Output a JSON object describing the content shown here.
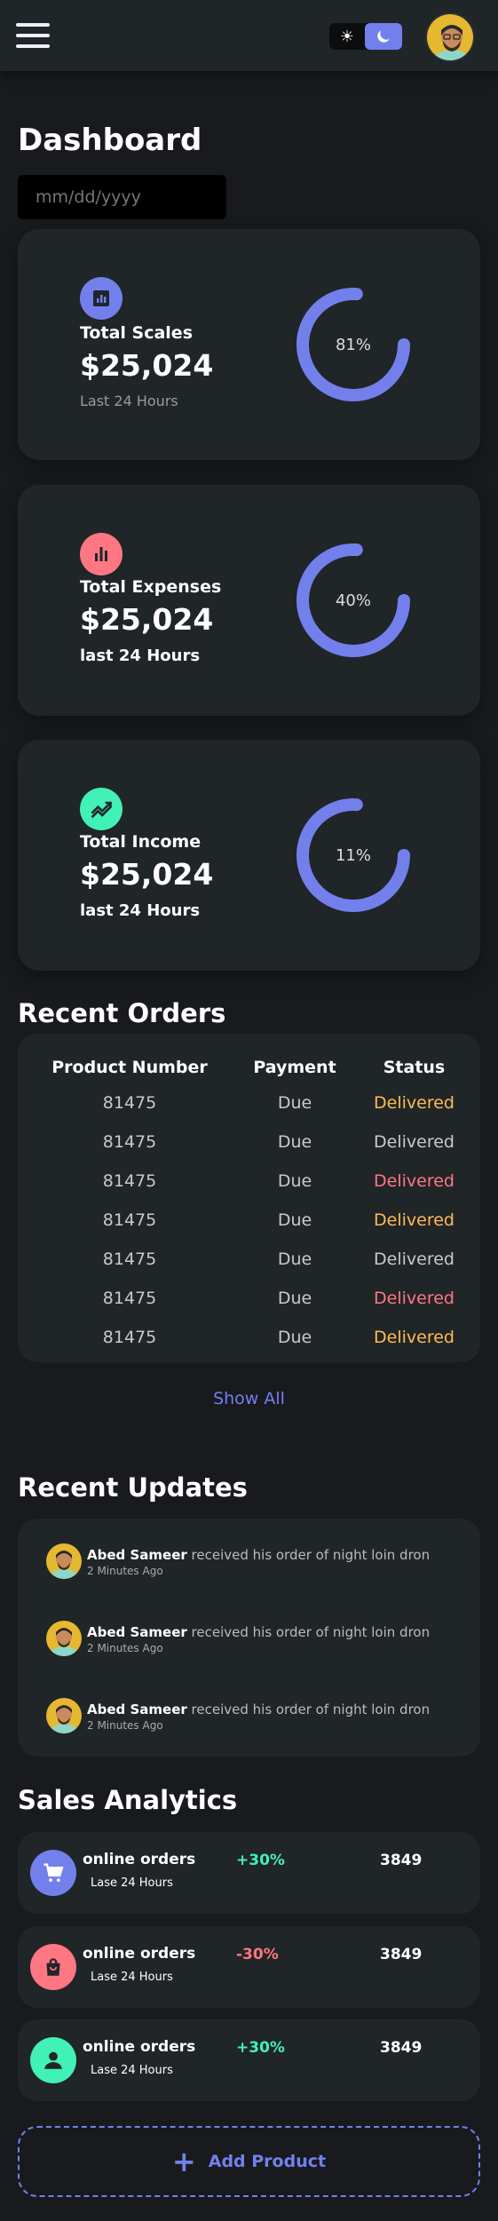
{
  "header": {
    "menu_icon": "hamburger-menu-icon",
    "theme_toggle": {
      "light_icon": "sun-icon",
      "dark_icon": "moon-icon",
      "active": "dark"
    },
    "avatar_icon": "user-avatar"
  },
  "page": {
    "title": "Dashboard",
    "date_placeholder": "mm/dd/yyyy"
  },
  "cards": [
    {
      "icon": "analytics-icon",
      "icon_color": "#7380ec",
      "label": "Total Scales",
      "amount": "$25,024",
      "sub": "Last 24 Hours",
      "percent_label": "81%",
      "percent": 0.81
    },
    {
      "icon": "bar-chart-icon",
      "icon_color": "#ff7782",
      "label": "Total Expenses",
      "amount": "$25,024",
      "sub": "last 24 Hours",
      "percent_label": "40%",
      "percent": 0.4
    },
    {
      "icon": "trending-up-icon",
      "icon_color": "#41f1b6",
      "label": "Total Income",
      "amount": "$25,024",
      "sub": "last 24 Hours",
      "percent_label": "11%",
      "percent": 0.11
    }
  ],
  "orders": {
    "title": "Recent Orders",
    "headers": [
      "Product Number",
      "Payment",
      "Status"
    ],
    "rows": [
      {
        "number": "81475",
        "payment": "Due",
        "status": "Delivered",
        "status_color": "orange"
      },
      {
        "number": "81475",
        "payment": "Due",
        "status": "Delivered",
        "status_color": "grey"
      },
      {
        "number": "81475",
        "payment": "Due",
        "status": "Delivered",
        "status_color": "red"
      },
      {
        "number": "81475",
        "payment": "Due",
        "status": "Delivered",
        "status_color": "orange"
      },
      {
        "number": "81475",
        "payment": "Due",
        "status": "Delivered",
        "status_color": "grey"
      },
      {
        "number": "81475",
        "payment": "Due",
        "status": "Delivered",
        "status_color": "red"
      },
      {
        "number": "81475",
        "payment": "Due",
        "status": "Delivered",
        "status_color": "orange"
      }
    ],
    "show_all": "Show All"
  },
  "updates": {
    "title": "Recent Updates",
    "items": [
      {
        "name": "Abed Sameer",
        "text": " received his order of night loin dron",
        "time": "2 Minutes Ago"
      },
      {
        "name": "Abed Sameer",
        "text": " received his order of night loin dron",
        "time": "2 Minutes Ago"
      },
      {
        "name": "Abed Sameer",
        "text": " received his order of night loin dron",
        "time": "2 Minutes Ago"
      }
    ]
  },
  "analytics": {
    "title": "Sales Analytics",
    "items": [
      {
        "icon": "shopping-cart-icon",
        "icon_color": "#7380ec",
        "title": "online orders",
        "sub": "Lase 24 Hours",
        "percent": "+30%",
        "percent_color": "#41f1b6",
        "value": "3849"
      },
      {
        "icon": "shopping-bag-icon",
        "icon_color": "#ff7782",
        "title": "online orders",
        "sub": "Lase 24 Hours",
        "percent": "-30%",
        "percent_color": "#ff7782",
        "value": "3849"
      },
      {
        "icon": "person-icon",
        "icon_color": "#41f1b6",
        "title": "online orders",
        "sub": "Lase 24 Hours",
        "percent": "+30%",
        "percent_color": "#41f1b6",
        "value": "3849"
      }
    ],
    "add_label": "Add Product"
  },
  "colors": {
    "primary": "#7380ec",
    "danger": "#ff7782",
    "success": "#41f1b6",
    "warning": "#ffbb55",
    "background": "#181a1e",
    "card": "#202528"
  }
}
